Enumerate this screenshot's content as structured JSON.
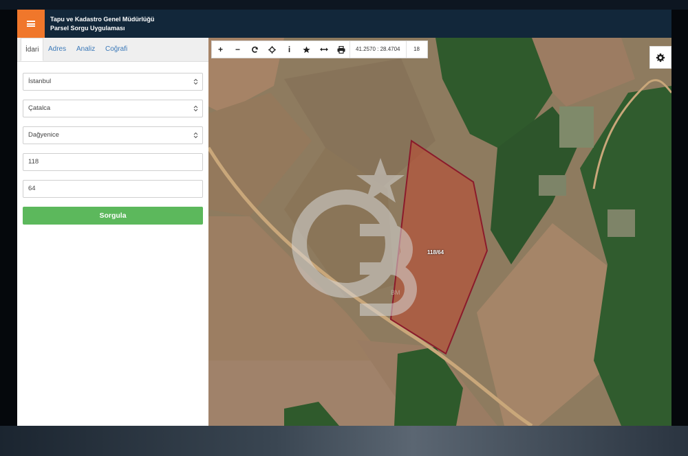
{
  "app": {
    "title_line1": "Tapu ve Kadastro Genel Müdürlüğü",
    "title_line2": "Parsel Sorgu Uygulaması",
    "menu_icon": "hamburger-icon",
    "accent_color": "#f0772b"
  },
  "tabs": [
    {
      "label": "İdari"
    },
    {
      "label": "Adres"
    },
    {
      "label": "Analiz"
    },
    {
      "label": "Coğrafi"
    }
  ],
  "form": {
    "province": "İstanbul",
    "district": "Çatalca",
    "neighborhood": "Dağyenice",
    "block": "118",
    "parcel": "64",
    "submit_label": "Sorgula",
    "submit_color": "#5cb85c"
  },
  "map": {
    "toolbar": {
      "zoom_in": "+",
      "zoom_out": "−",
      "refresh_icon": "refresh-icon",
      "locate_icon": "crosshair-icon",
      "info_label": "i",
      "favorite_icon": "star-icon",
      "measure_icon": "measure-icon",
      "print_icon": "print-icon",
      "coordinates": "41.2570 : 28.4704",
      "zoom_level": "18"
    },
    "parcel_label": "118/64",
    "parcel_border_color": "#8b1a2b",
    "watermark_text": "BM",
    "settings_icon": "gear-icon"
  }
}
